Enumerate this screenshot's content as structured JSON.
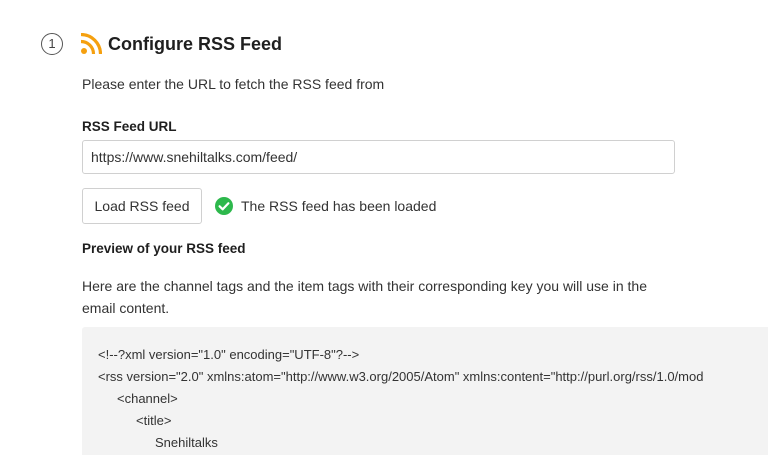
{
  "step": {
    "number": "1",
    "title": "Configure RSS Feed",
    "icon": "rss-icon"
  },
  "intro": "Please enter the URL to fetch the RSS feed from",
  "url_field": {
    "label": "RSS Feed URL",
    "value": "https://www.snehiltalks.com/feed/"
  },
  "load_button": {
    "label": "Load RSS feed"
  },
  "status": {
    "text": "The RSS feed has been loaded",
    "icon": "check-circle-icon",
    "color": "#2db84c"
  },
  "preview": {
    "heading": "Preview of your RSS feed",
    "description": "Here are the channel tags and the item tags with their corresponding key you will use in the email content.",
    "lines": [
      "<!--?xml version=\"1.0\" encoding=\"UTF-8\"?-->",
      "<rss version=\"2.0\" xmlns:atom=\"http://www.w3.org/2005/Atom\" xmlns:content=\"http://purl.org/rss/1.0/mod",
      "<channel>",
      "<title>",
      "Snehiltalks"
    ]
  },
  "colors": {
    "rss_orange": "#f5a00f",
    "success_green": "#2db84c",
    "code_background": "#f3f3f3"
  }
}
